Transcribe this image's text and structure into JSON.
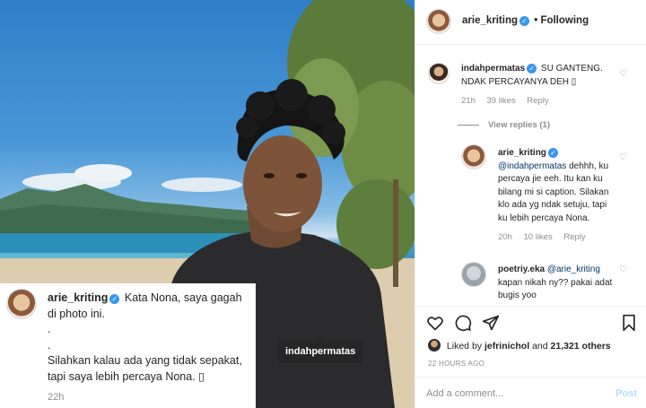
{
  "photo": {
    "tag_label": "indahpermatas"
  },
  "caption_overlay": {
    "username": "arie_kriting",
    "lines": [
      "Kata Nona, saya gagah",
      "di photo ini.",
      ".",
      ".",
      "Silahkan kalau ada yang tidak sepakat,",
      "tapi saya lebih percaya Nona. ▯"
    ],
    "time": "22h"
  },
  "header": {
    "username": "arie_kriting",
    "separator": "•",
    "follow_state": "Following"
  },
  "comments": [
    {
      "username": "indahpermatas",
      "text": "SU GANTENG. NDAK PERCAYANYA DEH ▯",
      "time": "21h",
      "likes": "39 likes",
      "reply_label": "Reply",
      "view_replies": "View replies (1)"
    },
    {
      "username": "arie_kriting",
      "mention": "@indahpermatas",
      "text": "dehhh, ku percaya jie eeh. Itu kan ku bilang mi si caption. Silakan klo ada yg ndak setuju, tapi ku lebih percaya Nona.",
      "time": "20h",
      "likes": "10 likes",
      "reply_label": "Reply"
    },
    {
      "username": "poetriy.eka",
      "mention": "@arie_kriting",
      "text": "kapan nikah ny?? pakai adat bugis yoo"
    }
  ],
  "actions": {
    "liked_by_prefix": "Liked by",
    "liked_by_user": "jefrinichol",
    "liked_by_joiner": "and",
    "liked_by_others": "21,321 others",
    "time_ago": "22 HOURS AGO"
  },
  "add_comment": {
    "placeholder": "Add a comment...",
    "post_label": "Post"
  },
  "icons": [
    "heart-icon",
    "comment-icon",
    "share-icon",
    "bookmark-icon",
    "verified-icon"
  ],
  "colors": {
    "verified": "#3897f0",
    "post_disabled": "#b2dffc",
    "muted": "#8e8e8e",
    "mention": "#00376b"
  }
}
